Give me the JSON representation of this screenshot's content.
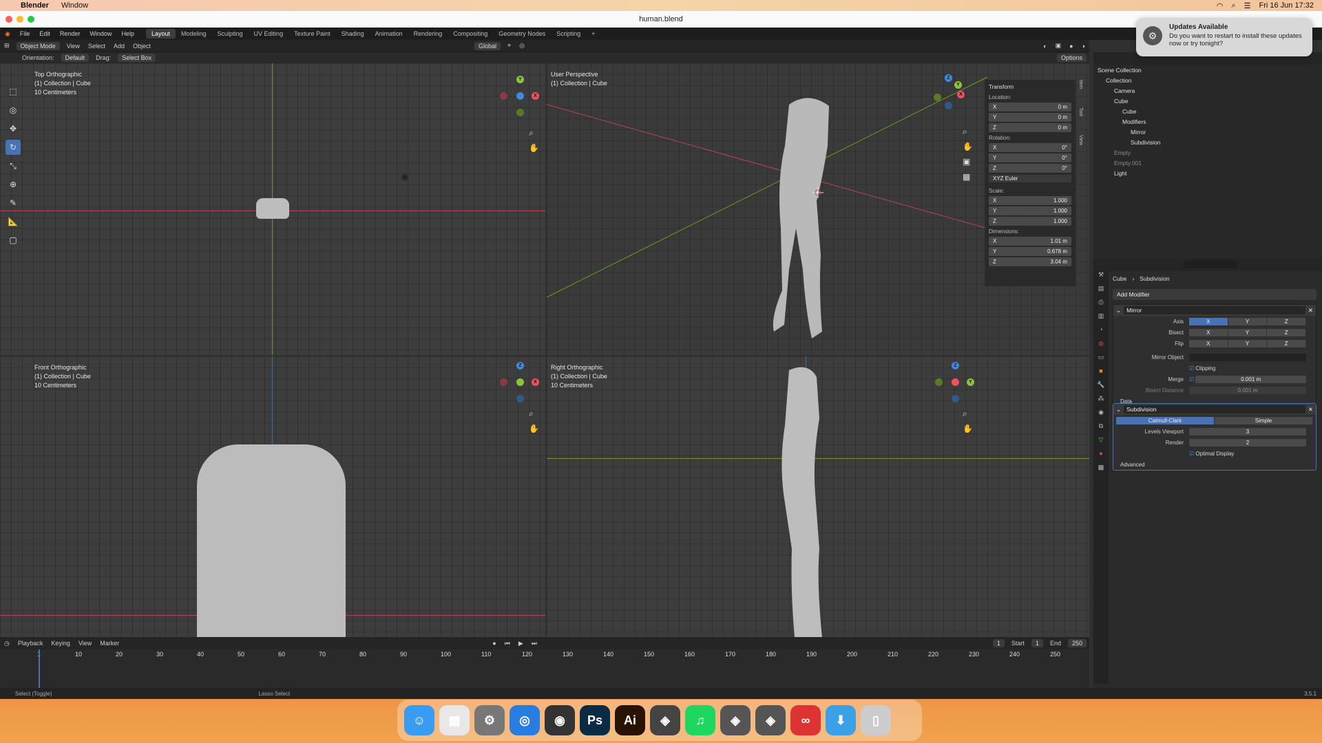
{
  "menubar": {
    "app": "Blender",
    "items": [
      "Window"
    ],
    "clock": "Fri 16 Jun  17:32"
  },
  "window": {
    "title": "human.blend"
  },
  "topbar": {
    "menus": [
      "File",
      "Edit",
      "Render",
      "Window",
      "Help"
    ],
    "workspaces": [
      "Layout",
      "Modeling",
      "Sculpting",
      "UV Editing",
      "Texture Paint",
      "Shading",
      "Animation",
      "Rendering",
      "Compositing",
      "Geometry Nodes",
      "Scripting",
      "+"
    ],
    "active": "Layout"
  },
  "header": {
    "mode": "Object Mode",
    "menus": [
      "View",
      "Select",
      "Add",
      "Object"
    ],
    "transform": "Global",
    "options": "Options"
  },
  "header2": {
    "orientation_label": "Orientation:",
    "orientation": "Default",
    "drag_label": "Drag:",
    "drag": "Select Box"
  },
  "viewports": {
    "top": {
      "l1": "Top Orthographic",
      "l2": "(1) Collection | Cube",
      "l3": "10 Centimeters"
    },
    "persp": {
      "l1": "User Perspective",
      "l2": "(1) Collection | Cube"
    },
    "front": {
      "l1": "Front Orthographic",
      "l2": "(1) Collection | Cube",
      "l3": "10 Centimeters"
    },
    "right": {
      "l1": "Right Orthographic",
      "l2": "(1) Collection | Cube",
      "l3": "10 Centimeters"
    }
  },
  "npanel": {
    "title": "Transform",
    "location": "Location:",
    "rotation": "Rotation:",
    "scale": "Scale:",
    "dimensions": "Dimensions:",
    "euler": "XYZ Euler",
    "loc": [
      {
        "a": "X",
        "v": "0 m"
      },
      {
        "a": "Y",
        "v": "0 m"
      },
      {
        "a": "Z",
        "v": "0 m"
      }
    ],
    "rot": [
      {
        "a": "X",
        "v": "0°"
      },
      {
        "a": "Y",
        "v": "0°"
      },
      {
        "a": "Z",
        "v": "0°"
      }
    ],
    "scl": [
      {
        "a": "X",
        "v": "1.000"
      },
      {
        "a": "Y",
        "v": "1.000"
      },
      {
        "a": "Z",
        "v": "1.000"
      }
    ],
    "dim": [
      {
        "a": "X",
        "v": "1.01 m"
      },
      {
        "a": "Y",
        "v": "0.678 m"
      },
      {
        "a": "Z",
        "v": "3.04 m"
      }
    ],
    "tabs": [
      "Item",
      "Tool",
      "View"
    ]
  },
  "outliner": {
    "items": [
      {
        "t": "Scene Collection",
        "d": 0,
        "dim": false
      },
      {
        "t": "Collection",
        "d": 1,
        "dim": false
      },
      {
        "t": "Camera",
        "d": 2,
        "dim": false
      },
      {
        "t": "Cube",
        "d": 2,
        "dim": false
      },
      {
        "t": "Cube",
        "d": 3,
        "dim": false
      },
      {
        "t": "Modifiers",
        "d": 3,
        "dim": false
      },
      {
        "t": "Mirror",
        "d": 4,
        "dim": false
      },
      {
        "t": "Subdivision",
        "d": 4,
        "dim": false
      },
      {
        "t": "Empty",
        "d": 2,
        "dim": true
      },
      {
        "t": "Empty.001",
        "d": 2,
        "dim": true
      },
      {
        "t": "Light",
        "d": 2,
        "dim": false
      }
    ]
  },
  "props": {
    "crumb_obj": "Cube",
    "crumb_mod": "Subdivision",
    "add_modifier": "Add Modifier",
    "mirror": {
      "name": "Mirror",
      "axis": "Axis",
      "bisect": "Bisect",
      "flip": "Flip",
      "xyz": [
        "X",
        "Y",
        "Z"
      ],
      "mirror_object": "Mirror Object",
      "clipping": "Clipping",
      "merge": "Merge",
      "merge_val": "0.001 m",
      "bisect_distance": "Bisect Distance",
      "bisect_val": "0.001 m",
      "data": "Data"
    },
    "subdiv": {
      "name": "Subdivision",
      "catmull": "Catmull-Clark",
      "simple": "Simple",
      "levels_viewport": "Levels Viewport",
      "levels_val": "3",
      "render": "Render",
      "render_val": "2",
      "optimal": "Optimal Display",
      "advanced": "Advanced"
    }
  },
  "timeline": {
    "menus": [
      "Playback",
      "Keying",
      "View",
      "Marker"
    ],
    "current": "1",
    "start_label": "Start",
    "start": "1",
    "end_label": "End",
    "end": "250",
    "ticks": [
      "1",
      "10",
      "20",
      "30",
      "40",
      "50",
      "60",
      "70",
      "80",
      "90",
      "100",
      "110",
      "120",
      "130",
      "140",
      "150",
      "160",
      "170",
      "180",
      "190",
      "200",
      "210",
      "220",
      "230",
      "240",
      "250"
    ]
  },
  "status": {
    "left": "Select (Toggle)",
    "mid": "Lasso Select",
    "version": "3.5.1"
  },
  "notification": {
    "title": "Updates Available",
    "body": "Do you want to restart to install these updates now or try tonight?"
  },
  "dock": [
    "Finder",
    "Launchpad",
    "Settings",
    "Safari",
    "Blender",
    "Ps",
    "Ai",
    "Unity",
    "Spotify",
    "Unity",
    "Unity",
    "Creative Cloud",
    "Downloads",
    "Trash"
  ]
}
